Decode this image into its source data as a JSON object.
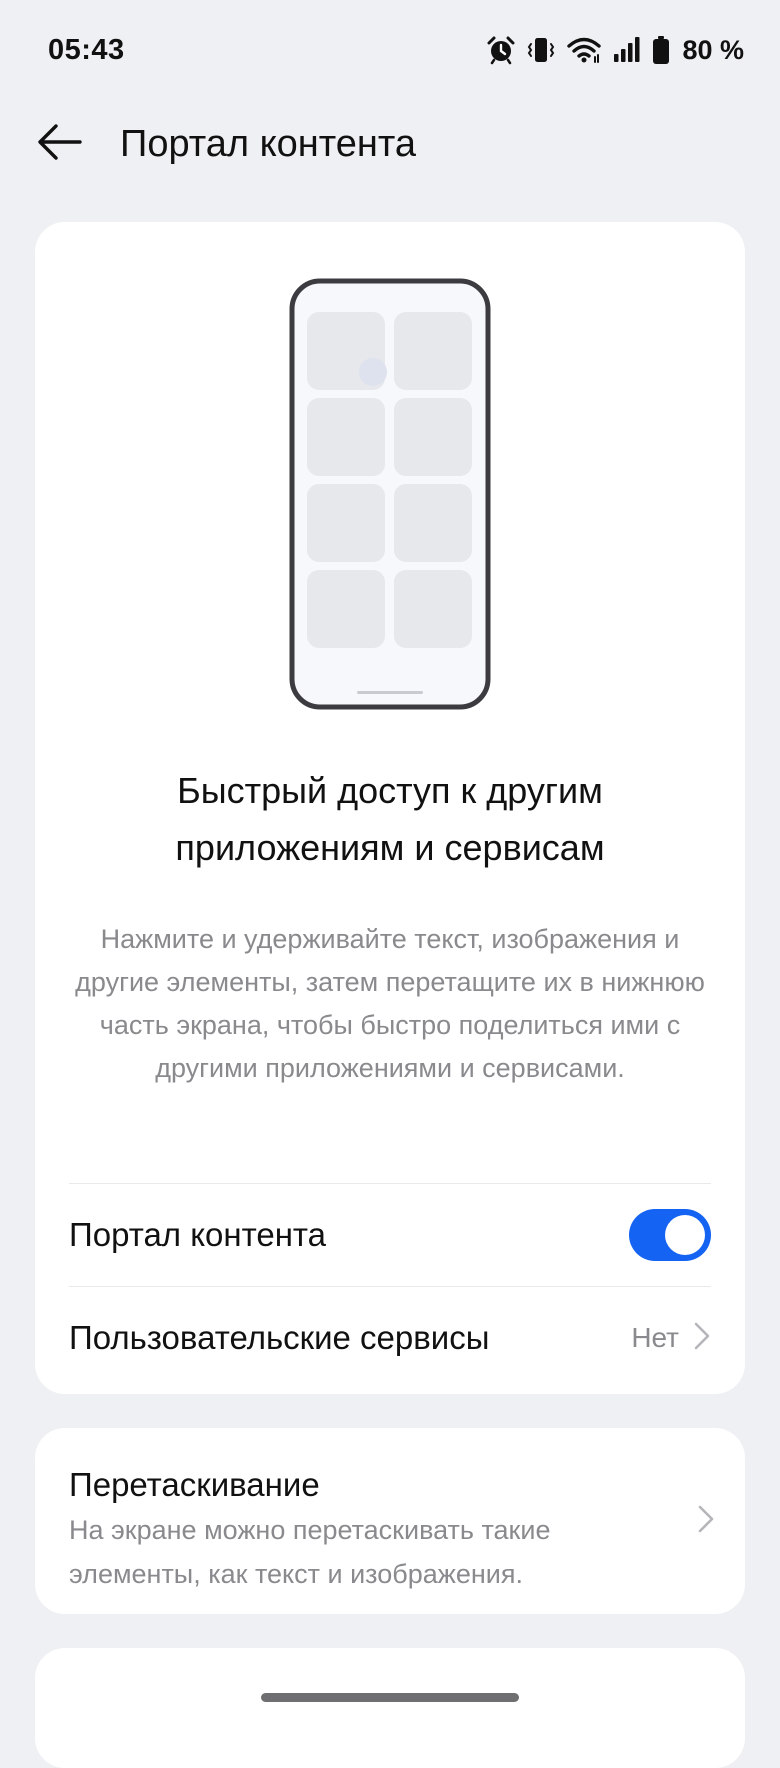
{
  "status_bar": {
    "time": "05:43",
    "battery": "80 %",
    "icons": [
      "alarm-icon",
      "vibrate-icon",
      "wifi-icon",
      "signal-icon",
      "battery-icon"
    ]
  },
  "app_bar": {
    "title": "Портал контента",
    "back_icon": "back-arrow-icon"
  },
  "hero": {
    "headline": "Быстрый доступ к другим приложениям и сервисам",
    "description": "Нажмите и удерживайте текст, изображения и другие элементы, затем перетащите их в нижнюю часть экрана, чтобы быстро поделиться ими с другими приложениями и сервисами."
  },
  "settings": {
    "portal_toggle": {
      "label": "Портал контента",
      "enabled": true
    },
    "custom_services": {
      "label": "Пользовательские сервисы",
      "value": "Нет"
    }
  },
  "drag_drop": {
    "title": "Перетаскивание",
    "description": "На экране можно перетаскивать такие элементы, как текст и изображения."
  },
  "colors": {
    "background": "#eff0f3",
    "accent": "#1463f3",
    "secondary_text": "#8a8a8e"
  }
}
